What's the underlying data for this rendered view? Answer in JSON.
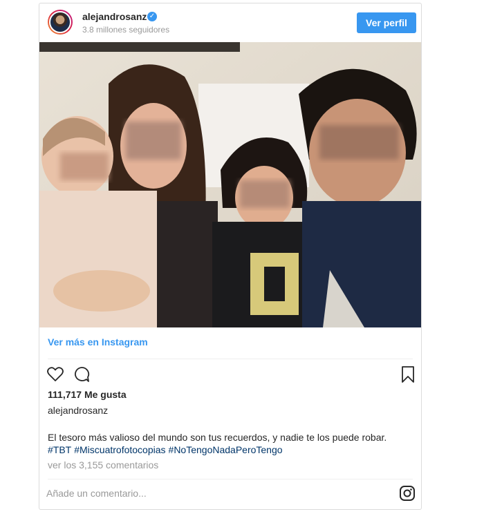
{
  "post": {
    "username": "alejandrosanz",
    "verified_mark": "✓",
    "followers": "3.8 millones seguidores",
    "follow_button": "Ver perfil"
  },
  "link": {
    "label": "Ver más en Instagram"
  },
  "actions": {
    "icons": [
      "heart-icon",
      "comment-icon",
      "bookmark-icon"
    ]
  },
  "likes": "111,717 Me gusta",
  "caption": {
    "author": "alejandrosanz",
    "text": "El tesoro más valioso del mundo son tus recuerdos, y nadie te los puede robar.",
    "hashtags": [
      "#TBT",
      "#Miscuatrofotocopias",
      "#NoTengoNadaPeroTengo"
    ]
  },
  "comments_link": "ver los 3,155 comentarios",
  "comment_box": {
    "placeholder": "Añade un comentario..."
  },
  "colors": {
    "accent": "#3897f0",
    "hashtag": "#003569",
    "muted": "#999999"
  }
}
